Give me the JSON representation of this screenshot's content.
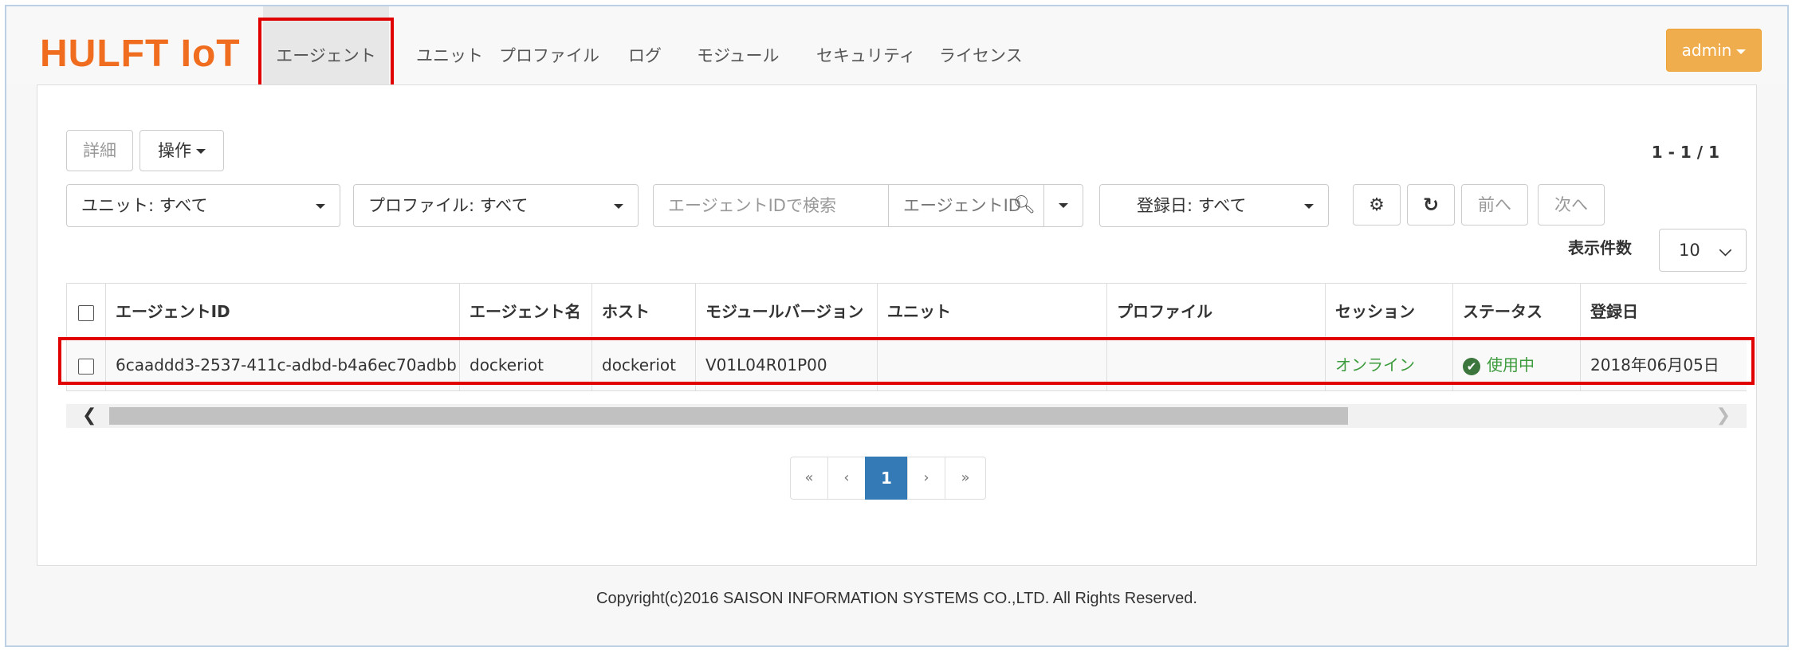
{
  "brand": {
    "logo": "HULFT IoT"
  },
  "nav": {
    "items": [
      "エージェント",
      "ユニット",
      "プロファイル",
      "ログ",
      "モジュール",
      "セキュリティ",
      "ライセンス"
    ],
    "active_index": 0
  },
  "user_menu": {
    "label": "admin"
  },
  "toolbar": {
    "detail_label": "詳細",
    "operation_label": "操作",
    "paging_info": "1 - 1 / 1",
    "unit_filter": "ユニット: すべて",
    "profile_filter": "プロファイル: すべて",
    "search_placeholder": "エージェントIDで検索",
    "search_field": "エージェントID",
    "date_filter": "登録日:  すべて",
    "prev_label": "前へ",
    "next_label": "次へ",
    "pagesize_label": "表示件数",
    "pagesize_value": "10"
  },
  "table": {
    "columns": [
      "エージェントID",
      "エージェント名",
      "ホスト",
      "モジュールバージョン",
      "ユニット",
      "プロファイル",
      "セッション",
      "ステータス",
      "登録日"
    ],
    "rows": [
      {
        "agent_id": "6caaddd3-2537-411c-adbd-b4a6ec70adbb",
        "agent_name": "dockeriot",
        "host": "dockeriot",
        "module_version": "V01L04R01P00",
        "unit": "",
        "profile": "",
        "session": "オンライン",
        "status": "使用中",
        "registered": "2018年06月05日"
      }
    ]
  },
  "pagination": {
    "first": "«",
    "prev": "‹",
    "current": "1",
    "next": "›",
    "last": "»"
  },
  "footer": {
    "copyright": "Copyright(c)2016 SAISON INFORMATION SYSTEMS CO.,LTD. All Rights Reserved."
  },
  "colors": {
    "brand": "#f06d1f",
    "admin_button": "#f0ad4e",
    "highlight": "#e00000",
    "online": "#3c9b3c",
    "page_active": "#337ab7"
  }
}
